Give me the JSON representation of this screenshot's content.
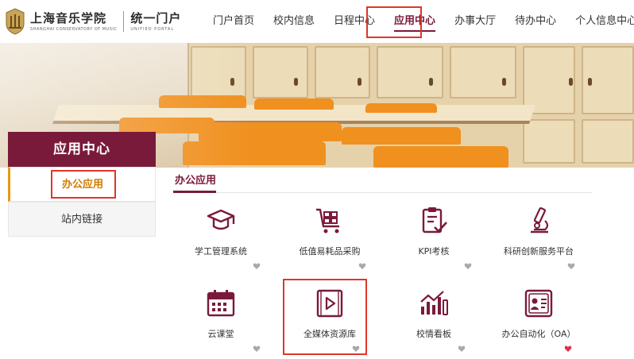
{
  "header": {
    "logo_cn": "上海音乐学院",
    "logo_en": "SHANGHAI CONSERVATORY OF MUSIC",
    "portal_cn": "统一门户",
    "portal_en": "UNIFIED PORTAL",
    "nav": [
      {
        "label": "门户首页",
        "active": false
      },
      {
        "label": "校内信息",
        "active": false
      },
      {
        "label": "日程中心",
        "active": false
      },
      {
        "label": "应用中心",
        "active": true
      },
      {
        "label": "办事大厅",
        "active": false
      },
      {
        "label": "待办中心",
        "active": false
      },
      {
        "label": "个人信息中心",
        "active": false
      }
    ]
  },
  "sidebar": {
    "title": "应用中心",
    "items": [
      {
        "label": "办公应用",
        "active": true
      },
      {
        "label": "站内链接",
        "active": false
      }
    ]
  },
  "content": {
    "section_title": "办公应用",
    "apps": [
      {
        "label": "学工管理系统",
        "icon": "graduation-cap-icon",
        "favorite": false
      },
      {
        "label": "低值易耗品采购",
        "icon": "shopping-cart-icon",
        "favorite": false
      },
      {
        "label": "KPI考核",
        "icon": "clipboard-check-icon",
        "favorite": false
      },
      {
        "label": "科研创新服务平台",
        "icon": "microscope-icon",
        "favorite": false
      },
      {
        "label": "云课堂",
        "icon": "calendar-icon",
        "favorite": false
      },
      {
        "label": "全媒体资源库",
        "icon": "video-file-icon",
        "favorite": false
      },
      {
        "label": "校情看板",
        "icon": "chart-dashboard-icon",
        "favorite": false
      },
      {
        "label": "办公自动化（OA）",
        "icon": "id-card-icon",
        "favorite": true
      }
    ]
  },
  "colors": {
    "brand": "#7a1a3a",
    "accent": "#e39a13",
    "highlight_box": "#e0352b",
    "heart_inactive": "#a9a9a9",
    "heart_active": "#e0304a"
  }
}
